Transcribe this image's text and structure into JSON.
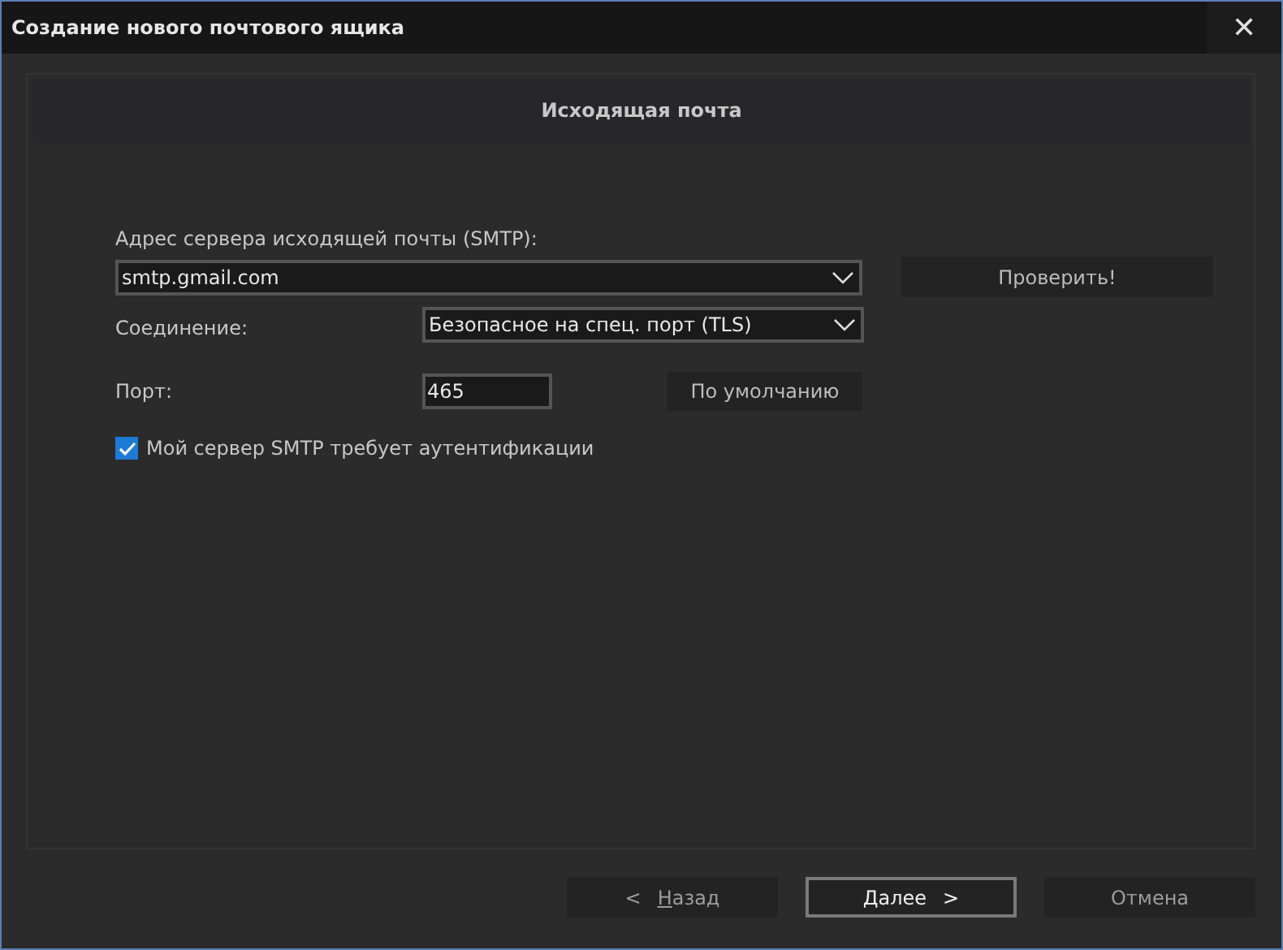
{
  "window": {
    "title": "Создание нового почтового ящика",
    "close": "✕"
  },
  "header": {
    "title": "Исходящая почта"
  },
  "server": {
    "label": "Адрес сервера исходящей почты (SMTP):",
    "value": "smtp.gmail.com",
    "check_button": "Проверить!"
  },
  "connection": {
    "label": "Соединение:",
    "value": "Безопасное на спец. порт (TLS)"
  },
  "port": {
    "label": "Порт:",
    "value": "465",
    "default_button": "По умолчанию"
  },
  "auth": {
    "label": "Мой сервер SMTP требует аутентификации",
    "checked": true
  },
  "buttons": [
    {
      "kind": "back",
      "label": "Назад",
      "arrow": "<",
      "default": false
    },
    {
      "kind": "next",
      "label": "Далее",
      "arrow": ">",
      "default": true
    },
    {
      "kind": "cancel",
      "label": "Отмена",
      "default": false
    }
  ]
}
